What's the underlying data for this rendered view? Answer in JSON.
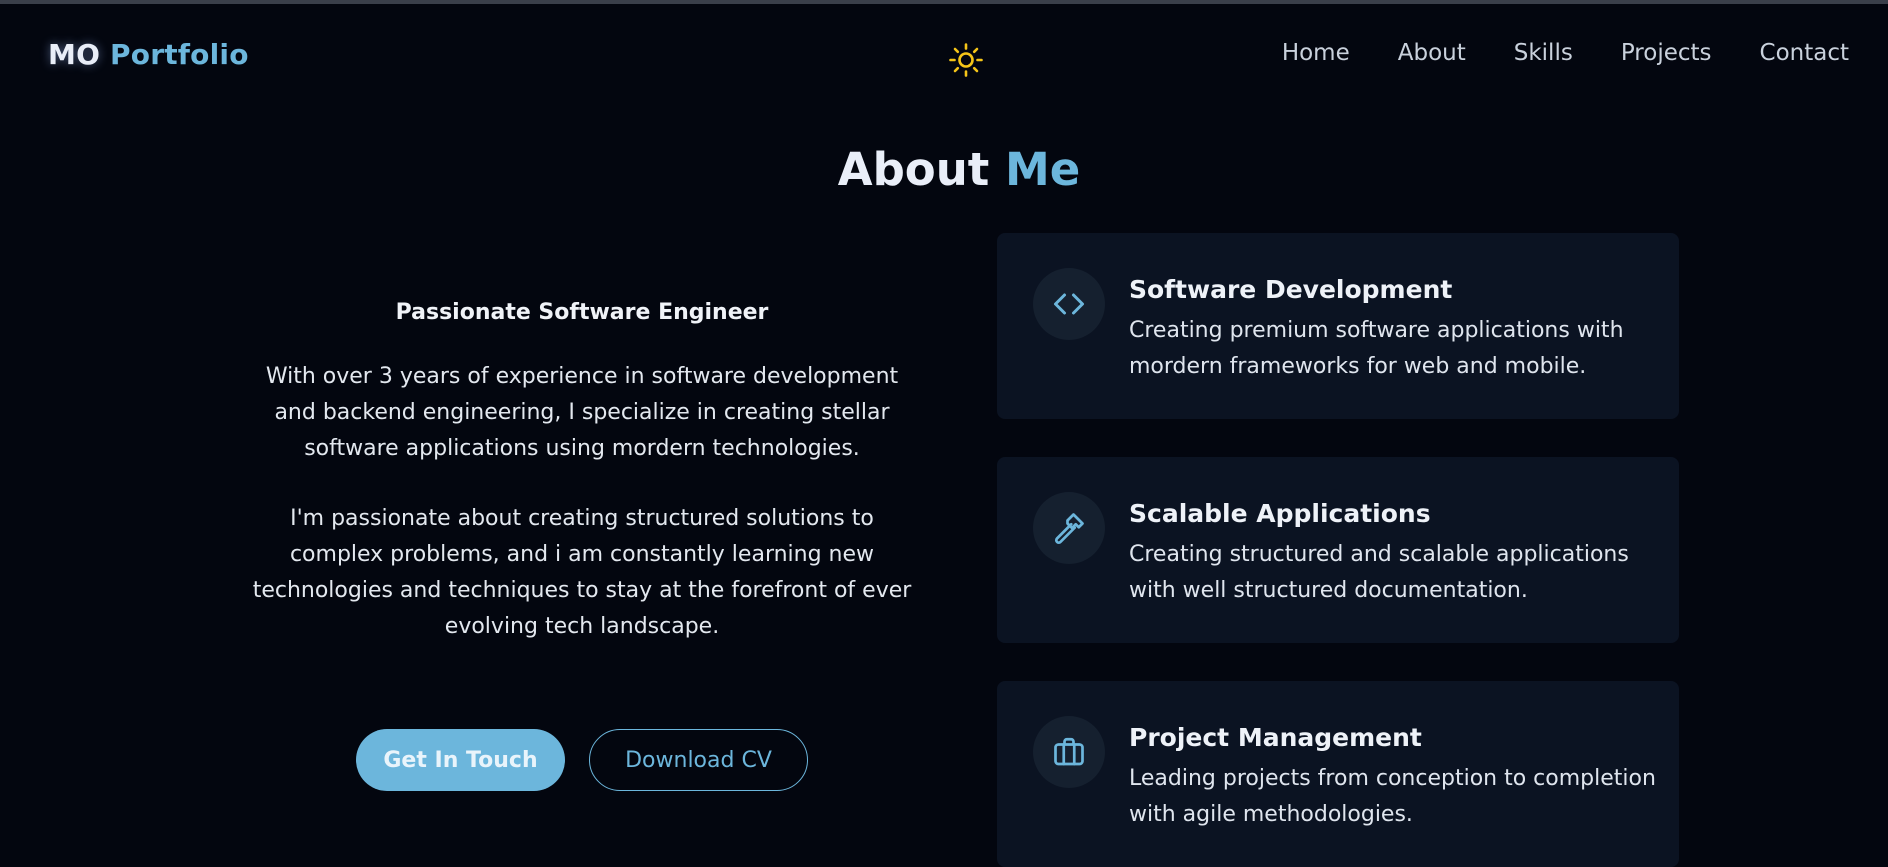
{
  "brand": {
    "prefix": "MO",
    "highlight": "Portfolio"
  },
  "nav": {
    "items": [
      "Home",
      "About",
      "Skills",
      "Projects",
      "Contact"
    ]
  },
  "theme_toggle": {
    "icon": "sun-icon"
  },
  "section": {
    "title_word": "About",
    "title_highlight": "Me"
  },
  "intro": {
    "heading": "Passionate Software Engineer",
    "paragraph1": "With over 3 years of experience in software development and backend engineering, I specialize in creating stellar software applications using mordern technologies.",
    "paragraph2": "I'm passionate about creating structured solutions to complex problems, and i am constantly learning new technologies and techniques to stay at the forefront of ever evolving tech landscape."
  },
  "buttons": {
    "primary": "Get In Touch",
    "secondary": "Download CV"
  },
  "cards": [
    {
      "icon": "code-icon",
      "title": "Software Development",
      "description": "Creating premium software applications with mordern frameworks for web and mobile."
    },
    {
      "icon": "hammer-icon",
      "title": "Scalable Applications",
      "description": "Creating structured and scalable applications with well structured documentation."
    },
    {
      "icon": "briefcase-icon",
      "title": "Project Management",
      "description": "Leading projects from conception to completion with agile methodologies."
    }
  ],
  "colors": {
    "accent": "#6cb6dc",
    "background": "#03060f",
    "card": "#0b1322",
    "sun": "#f5c518"
  }
}
